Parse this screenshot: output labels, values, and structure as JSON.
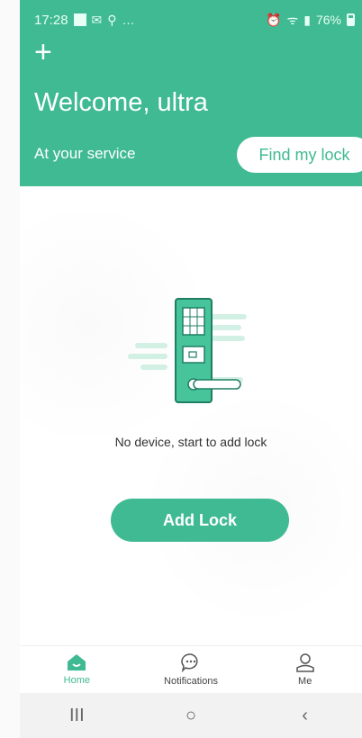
{
  "status_bar": {
    "time": "17:28",
    "battery": "76%"
  },
  "header": {
    "add_icon": "plus-icon",
    "welcome": "Welcome, ultra",
    "subtitle": "At your service",
    "find_button": "Find my lock"
  },
  "main": {
    "empty_message": "No device, start to add lock",
    "add_button": "Add Lock"
  },
  "tabs": [
    {
      "label": "Home",
      "icon": "home-icon",
      "active": true
    },
    {
      "label": "Notifications",
      "icon": "chat-bubble-icon",
      "active": false
    },
    {
      "label": "Me",
      "icon": "user-icon",
      "active": false
    }
  ],
  "nav_bar": {
    "recent": "III",
    "home": "○",
    "back": "‹"
  },
  "colors": {
    "accent": "#40ba92",
    "white": "#ffffff"
  }
}
